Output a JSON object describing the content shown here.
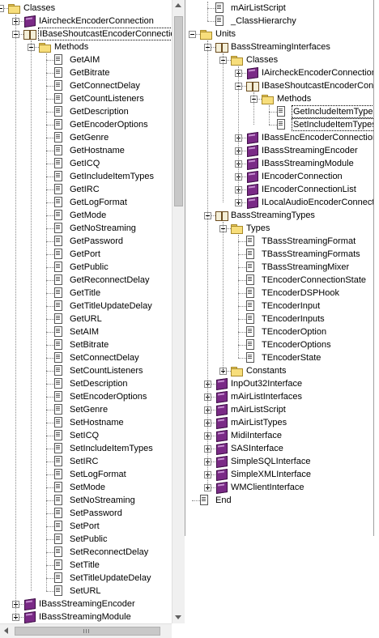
{
  "left_tree": [
    {
      "label": "Classes",
      "icon": "folder",
      "depth": 0,
      "expander": "minus",
      "selected": false
    },
    {
      "label": "IAircheckEncoderConnection",
      "icon": "book",
      "depth": 1,
      "expander": "plus",
      "selected": false
    },
    {
      "label": "IBaseShoutcastEncoderConnection",
      "icon": "open-book",
      "depth": 1,
      "expander": "minus",
      "selected": true
    },
    {
      "label": "Methods",
      "icon": "folder",
      "depth": 2,
      "expander": "minus",
      "selected": false
    },
    {
      "label": "GetAIM",
      "icon": "doc",
      "depth": 3
    },
    {
      "label": "GetBitrate",
      "icon": "doc",
      "depth": 3
    },
    {
      "label": "GetConnectDelay",
      "icon": "doc",
      "depth": 3
    },
    {
      "label": "GetCountListeners",
      "icon": "doc",
      "depth": 3
    },
    {
      "label": "GetDescription",
      "icon": "doc",
      "depth": 3
    },
    {
      "label": "GetEncoderOptions",
      "icon": "doc",
      "depth": 3
    },
    {
      "label": "GetGenre",
      "icon": "doc",
      "depth": 3
    },
    {
      "label": "GetHostname",
      "icon": "doc",
      "depth": 3
    },
    {
      "label": "GetICQ",
      "icon": "doc",
      "depth": 3
    },
    {
      "label": "GetIncludeItemTypes",
      "icon": "doc",
      "depth": 3
    },
    {
      "label": "GetIRC",
      "icon": "doc",
      "depth": 3
    },
    {
      "label": "GetLogFormat",
      "icon": "doc",
      "depth": 3
    },
    {
      "label": "GetMode",
      "icon": "doc",
      "depth": 3
    },
    {
      "label": "GetNoStreaming",
      "icon": "doc",
      "depth": 3
    },
    {
      "label": "GetPassword",
      "icon": "doc",
      "depth": 3
    },
    {
      "label": "GetPort",
      "icon": "doc",
      "depth": 3
    },
    {
      "label": "GetPublic",
      "icon": "doc",
      "depth": 3
    },
    {
      "label": "GetReconnectDelay",
      "icon": "doc",
      "depth": 3
    },
    {
      "label": "GetTitle",
      "icon": "doc",
      "depth": 3
    },
    {
      "label": "GetTitleUpdateDelay",
      "icon": "doc",
      "depth": 3
    },
    {
      "label": "GetURL",
      "icon": "doc",
      "depth": 3
    },
    {
      "label": "SetAIM",
      "icon": "doc",
      "depth": 3
    },
    {
      "label": "SetBitrate",
      "icon": "doc",
      "depth": 3
    },
    {
      "label": "SetConnectDelay",
      "icon": "doc",
      "depth": 3
    },
    {
      "label": "SetCountListeners",
      "icon": "doc",
      "depth": 3
    },
    {
      "label": "SetDescription",
      "icon": "doc",
      "depth": 3
    },
    {
      "label": "SetEncoderOptions",
      "icon": "doc",
      "depth": 3
    },
    {
      "label": "SetGenre",
      "icon": "doc",
      "depth": 3
    },
    {
      "label": "SetHostname",
      "icon": "doc",
      "depth": 3
    },
    {
      "label": "SetICQ",
      "icon": "doc",
      "depth": 3
    },
    {
      "label": "SetIncludeItemTypes",
      "icon": "doc",
      "depth": 3
    },
    {
      "label": "SetIRC",
      "icon": "doc",
      "depth": 3
    },
    {
      "label": "SetLogFormat",
      "icon": "doc",
      "depth": 3
    },
    {
      "label": "SetMode",
      "icon": "doc",
      "depth": 3
    },
    {
      "label": "SetNoStreaming",
      "icon": "doc",
      "depth": 3
    },
    {
      "label": "SetPassword",
      "icon": "doc",
      "depth": 3
    },
    {
      "label": "SetPort",
      "icon": "doc",
      "depth": 3
    },
    {
      "label": "SetPublic",
      "icon": "doc",
      "depth": 3
    },
    {
      "label": "SetReconnectDelay",
      "icon": "doc",
      "depth": 3
    },
    {
      "label": "SetTitle",
      "icon": "doc",
      "depth": 3
    },
    {
      "label": "SetTitleUpdateDelay",
      "icon": "doc",
      "depth": 3
    },
    {
      "label": "SetURL",
      "icon": "doc",
      "depth": 3
    },
    {
      "label": "IBassStreamingEncoder",
      "icon": "book",
      "depth": 1,
      "expander": "plus",
      "selected": false
    },
    {
      "label": "IBassStreamingModule",
      "icon": "book",
      "depth": 1,
      "expander": "plus",
      "selected": false
    }
  ],
  "right_tree": [
    {
      "label": "mAirListScript",
      "icon": "doc",
      "depth": 1
    },
    {
      "label": "_ClassHierarchy",
      "icon": "doc",
      "depth": 1
    },
    {
      "label": "Units",
      "icon": "folder",
      "depth": 0,
      "expander": "minus"
    },
    {
      "label": "BassStreamingInterfaces",
      "icon": "open-book",
      "depth": 1,
      "expander": "minus"
    },
    {
      "label": "Classes",
      "icon": "folder",
      "depth": 2,
      "expander": "minus"
    },
    {
      "label": "IAircheckEncoderConnection",
      "icon": "book",
      "depth": 3,
      "expander": "plus"
    },
    {
      "label": "IBaseShoutcastEncoderConnection",
      "icon": "open-book",
      "depth": 3,
      "expander": "minus"
    },
    {
      "label": "Methods",
      "icon": "folder",
      "depth": 4,
      "expander": "minus"
    },
    {
      "label": "GetIncludeItemTypes",
      "icon": "doc",
      "depth": 5,
      "boxed": true
    },
    {
      "label": "SetIncludeItemTypes",
      "icon": "doc",
      "depth": 5,
      "boxed": true
    },
    {
      "label": "IBassEncEncoderConnection",
      "icon": "book",
      "depth": 3,
      "expander": "plus"
    },
    {
      "label": "IBassStreamingEncoder",
      "icon": "book",
      "depth": 3,
      "expander": "plus"
    },
    {
      "label": "IBassStreamingModule",
      "icon": "book",
      "depth": 3,
      "expander": "plus"
    },
    {
      "label": "IEncoderConnection",
      "icon": "book",
      "depth": 3,
      "expander": "plus"
    },
    {
      "label": "IEncoderConnectionList",
      "icon": "book",
      "depth": 3,
      "expander": "plus"
    },
    {
      "label": "ILocalAudioEncoderConnection",
      "icon": "book",
      "depth": 3,
      "expander": "plus"
    },
    {
      "label": "BassStreamingTypes",
      "icon": "open-book",
      "depth": 1,
      "expander": "minus"
    },
    {
      "label": "Types",
      "icon": "folder",
      "depth": 2,
      "expander": "minus"
    },
    {
      "label": "TBassStreamingFormat",
      "icon": "doc",
      "depth": 3
    },
    {
      "label": "TBassStreamingFormats",
      "icon": "doc",
      "depth": 3
    },
    {
      "label": "TBassStreamingMixer",
      "icon": "doc",
      "depth": 3
    },
    {
      "label": "TEncoderConnectionState",
      "icon": "doc",
      "depth": 3
    },
    {
      "label": "TEncoderDSPHook",
      "icon": "doc",
      "depth": 3
    },
    {
      "label": "TEncoderInput",
      "icon": "doc",
      "depth": 3
    },
    {
      "label": "TEncoderInputs",
      "icon": "doc",
      "depth": 3
    },
    {
      "label": "TEncoderOption",
      "icon": "doc",
      "depth": 3
    },
    {
      "label": "TEncoderOptions",
      "icon": "doc",
      "depth": 3
    },
    {
      "label": "TEncoderState",
      "icon": "doc",
      "depth": 3
    },
    {
      "label": "Constants",
      "icon": "folder",
      "depth": 2,
      "expander": "plus"
    },
    {
      "label": "InpOut32Interface",
      "icon": "book",
      "depth": 1,
      "expander": "plus"
    },
    {
      "label": "mAirListInterfaces",
      "icon": "book",
      "depth": 1,
      "expander": "plus"
    },
    {
      "label": "mAirListScript",
      "icon": "book",
      "depth": 1,
      "expander": "plus"
    },
    {
      "label": "mAirListTypes",
      "icon": "book",
      "depth": 1,
      "expander": "plus"
    },
    {
      "label": "MidiInterface",
      "icon": "book",
      "depth": 1,
      "expander": "plus"
    },
    {
      "label": "SASInterface",
      "icon": "book",
      "depth": 1,
      "expander": "plus"
    },
    {
      "label": "SimpleSQLInterface",
      "icon": "book",
      "depth": 1,
      "expander": "plus"
    },
    {
      "label": "SimpleXMLInterface",
      "icon": "book",
      "depth": 1,
      "expander": "plus"
    },
    {
      "label": "WMClientInterface",
      "icon": "book",
      "depth": 1,
      "expander": "plus"
    },
    {
      "label": "End",
      "icon": "doc",
      "depth": 0
    }
  ],
  "colors": {
    "book": "#7a2a86",
    "folder": "#f7de7c",
    "tree_line": "#888888",
    "scrollbar": "#f0f0f0"
  }
}
